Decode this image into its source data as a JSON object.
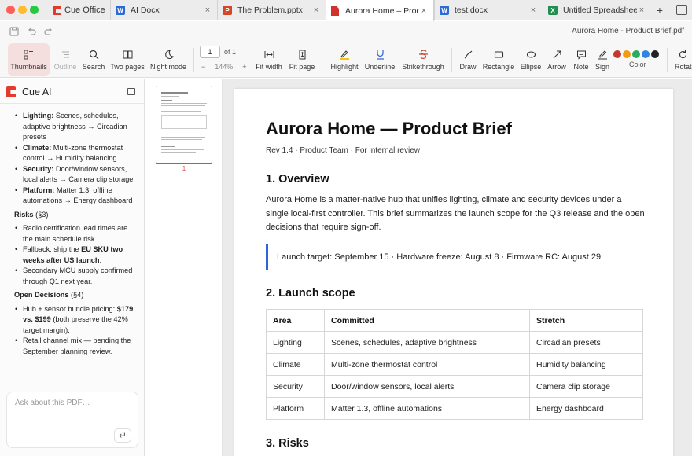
{
  "app": {
    "name": "Cue Office"
  },
  "tabs": [
    {
      "label": "AI Docx",
      "kind": "word",
      "badge": "W"
    },
    {
      "label": "The Problem.pptx",
      "kind": "ppt",
      "badge": "P"
    },
    {
      "label": "Aurora Home – Produc…",
      "kind": "pdf",
      "badge": "",
      "active": true
    },
    {
      "label": "test.docx",
      "kind": "word",
      "badge": "W"
    },
    {
      "label": "Untitled Spreadsheet.…",
      "kind": "xls",
      "badge": "X"
    }
  ],
  "tab_close_glyph": "×",
  "tab_add_glyph": "+",
  "window_title": "Aurora Home - Product Brief.pdf",
  "toolbar": {
    "thumbnails": "Thumbnails",
    "outline": "Outline",
    "search": "Search",
    "two_pages": "Two pages",
    "night_mode": "Night mode",
    "page_current": "1",
    "page_of": "of 1",
    "zoom_minus": "−",
    "zoom_value": "144%",
    "zoom_plus": "+",
    "fit_width": "Fit width",
    "fit_page": "Fit page",
    "highlight": "Highlight",
    "underline": "Underline",
    "strikethrough": "Strikethrough",
    "draw": "Draw",
    "rectangle": "Rectangle",
    "ellipse": "Ellipse",
    "arrow": "Arrow",
    "note": "Note",
    "sign": "Sign",
    "color": "Color",
    "rotate": "Rotate",
    "swatch_colors": [
      "#c0392b",
      "#f39c12",
      "#27ae60",
      "#2e86de",
      "#222222"
    ]
  },
  "sidebar": {
    "title": "Cue AI",
    "scope_items": [
      {
        "bold": "Lighting:",
        "text": " Scenes, schedules, adaptive brightness → Circadian presets"
      },
      {
        "bold": "Climate:",
        "text": " Multi-zone thermostat control → Humidity balancing"
      },
      {
        "bold": "Security:",
        "text": " Door/window sensors, local alerts → Camera clip storage"
      },
      {
        "bold": "Platform:",
        "text": " Matter 1.3, offline automations → Energy dashboard"
      }
    ],
    "risks_heading": "Risks",
    "risks_ref": " (§3)",
    "risks": [
      {
        "pre": "Radio certification lead times are the main schedule risk.",
        "bold": "",
        "post": ""
      },
      {
        "pre": "Fallback: ship the ",
        "bold": "EU SKU two weeks after US launch",
        "post": "."
      },
      {
        "pre": "Secondary MCU supply confirmed through Q1 next year.",
        "bold": "",
        "post": ""
      }
    ],
    "decisions_heading": "Open Decisions",
    "decisions_ref": " (§4)",
    "decisions": [
      {
        "pre": "Hub + sensor bundle pricing: ",
        "bold": "$179 vs. $199",
        "post": " (both preserve the 42% target margin)."
      },
      {
        "pre": "Retail channel mix — pending the September planning review.",
        "bold": "",
        "post": ""
      }
    ],
    "chat_placeholder": "Ask about this PDF…",
    "send_glyph": "↵"
  },
  "thumbnail": {
    "page_number": "1"
  },
  "document": {
    "title": "Aurora Home — Product Brief",
    "subtitle": "Rev 1.4 · Product Team · For internal review",
    "h_overview": "1. Overview",
    "overview": "Aurora Home is a matter-native hub that unifies lighting, climate and security devices under a single local-first controller. This brief summarizes the launch scope for the Q3 release and the open decisions that require sign-off.",
    "callout": "Launch target: September 15 · Hardware freeze: August 8 · Firmware RC: August 29",
    "h_scope": "2. Launch scope",
    "table_headers": [
      "Area",
      "Committed",
      "Stretch"
    ],
    "table_rows": [
      [
        "Lighting",
        "Scenes, schedules, adaptive brightness",
        "Circadian presets"
      ],
      [
        "Climate",
        "Multi-zone thermostat control",
        "Humidity balancing"
      ],
      [
        "Security",
        "Door/window sensors, local alerts",
        "Camera clip storage"
      ],
      [
        "Platform",
        "Matter 1.3, offline automations",
        "Energy dashboard"
      ]
    ],
    "h_risks": "3. Risks"
  }
}
